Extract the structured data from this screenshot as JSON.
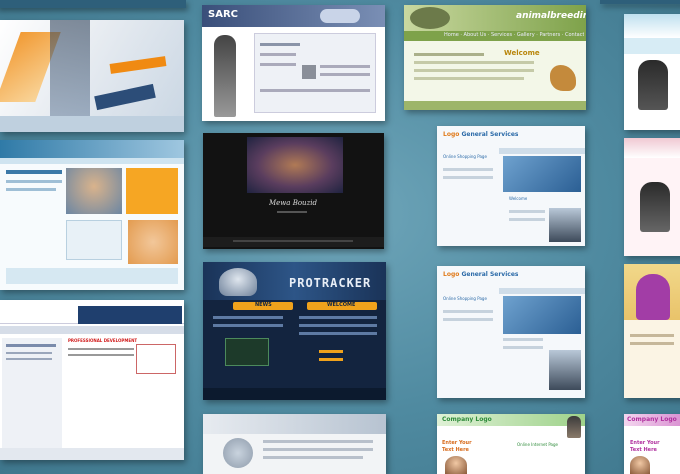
{
  "gallery": {
    "animal_breeding": {
      "logo": "animalbreeding",
      "nav": [
        "Home",
        "About Us",
        "Services",
        "Gallery",
        "Partners",
        "Contact"
      ],
      "welcome": "Welcome"
    },
    "protracker": {
      "logo": "PROTRACKER",
      "news": "NEWS",
      "welcome": "WELCOME"
    },
    "dark_portfolio": {
      "name": "Mewa Bouzid"
    },
    "logo_general_a": {
      "logo_colored": "Logo",
      "logo_rest": "General Services",
      "title_a": "Online Shopping Page",
      "title_b": "Welcome"
    },
    "logo_general_b": {
      "logo_colored": "Logo",
      "logo_rest": "General Services",
      "title_a": "Online Shopping Page"
    },
    "company_logo_a": {
      "logo": "Company Logo",
      "enter_line1": "Enter Your",
      "enter_line2": "Text Here",
      "online_page": "Online Internet Page"
    },
    "company_logo_b": {
      "logo": "Company Logo",
      "enter_line1": "Enter Your",
      "enter_line2": "Text Here"
    },
    "blue_corporate": {
      "headline": "PROFESSIONAL DEVELOPMENT"
    }
  },
  "colors": {
    "background": "#4f8aa0",
    "animal_green": "#7ea24a",
    "protracker_navy": "#13243f",
    "logo_blue": "#2b6aa8",
    "company_green": "#2e8b3a"
  }
}
